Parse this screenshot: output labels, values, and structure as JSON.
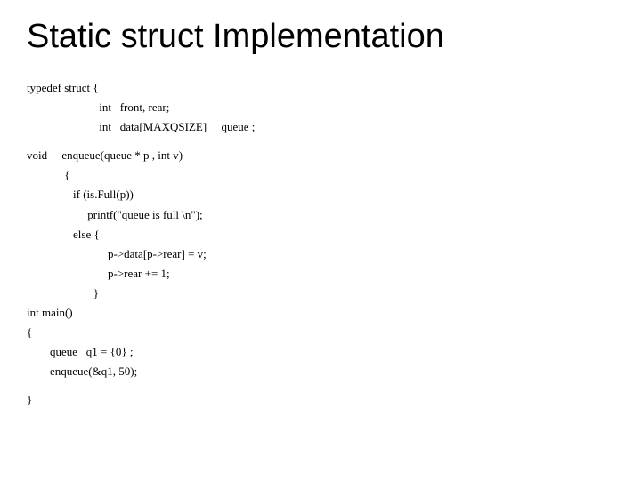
{
  "title": "Static struct Implementation",
  "lines": {
    "l0": "typedef struct {",
    "l1": "                         int   front, rear;",
    "l2": "                         int   data[MAXQSIZE]     queue ;",
    "l3": "void     enqueue(queue * p , int v)",
    "l4": "             {",
    "l5": "                if (is.Full(p))",
    "l6": "                     printf(\"queue is full \\n\");",
    "l7": "                else {",
    "l8": "                            p->data[p->rear] = v;",
    "l9": "                            p->rear += 1;",
    "l10": "                       }",
    "l11": "int main()",
    "l12": "{",
    "l13": "        queue   q1 = {0} ;",
    "l14": "        enqueue(&q1, 50);",
    "l15": "}"
  }
}
